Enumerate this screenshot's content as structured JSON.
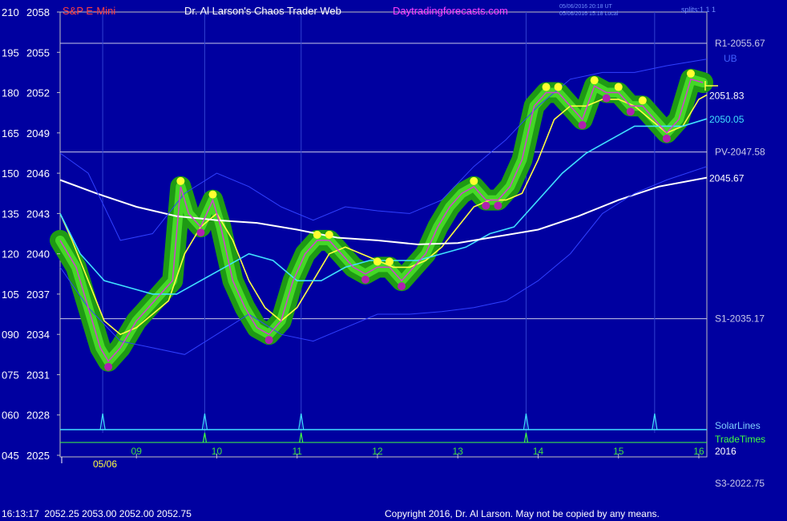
{
  "header": {
    "instrument": "S&P E-Mini",
    "site_title": "Dr. Al Larson's Chaos Trader Web",
    "site_url": "Daytradingforecasts.com",
    "timestamp_ut": "05/06/2016 20:18 UT",
    "timestamp_local": "05/06/2016 15:18 Local",
    "splits": "splits:1 1 1"
  },
  "footer": {
    "quote": "16:13:17  2052.25 2053.00 2052.00 2052.75",
    "copyright": "Copyright 2016, Dr. Al Larson. May not be copied by any means."
  },
  "chart_data": {
    "type": "line",
    "x_tick_labels": [
      "09",
      "10",
      "11",
      "12",
      "13",
      "14",
      "15",
      "16"
    ],
    "x_tick_hours": [
      9,
      10,
      11,
      12,
      13,
      14,
      15,
      16
    ],
    "date_label": "05/06",
    "year_label": "2016",
    "xlim": [
      8.05,
      16.1
    ],
    "ylim": [
      2025,
      2058
    ],
    "price_ticks": [
      2025,
      2028,
      2031,
      2034,
      2037,
      2040,
      2043,
      2046,
      2049,
      2052,
      2055,
      2058
    ],
    "osc_ticks": [
      "045",
      "060",
      "075",
      "090",
      "105",
      "120",
      "135",
      "150",
      "165",
      "180",
      "195",
      "210"
    ],
    "levels": [
      {
        "label": "R1-2055.67",
        "value": 2055.67,
        "color": "#c8c8e8"
      },
      {
        "label": "PV-2047.58",
        "value": 2047.58,
        "color": "#c8c8e8"
      },
      {
        "label": "S1-2035.17",
        "value": 2035.17,
        "color": "#c8c8e8"
      }
    ],
    "offchart_levels": [
      "S3-2022.75"
    ],
    "value_labels": [
      {
        "text": "2051.83",
        "value": 2051.83,
        "color": "#ffffff"
      },
      {
        "text": "2050.05",
        "value": 2050.05,
        "color": "#40e0ff"
      },
      {
        "text": "2045.67",
        "value": 2045.67,
        "color": "#ffffff"
      }
    ],
    "ub_label": "UB",
    "lower_labels": [
      "SolarLines",
      "TradeTimes"
    ],
    "timing_lines": [
      8.58,
      9.85,
      11.05,
      13.85,
      15.45
    ],
    "series": [
      {
        "role": "price",
        "color": "#a0ff40",
        "x": [
          8.05,
          8.15,
          8.25,
          8.4,
          8.55,
          8.65,
          8.8,
          9,
          9.15,
          9.3,
          9.45,
          9.55,
          9.65,
          9.8,
          9.95,
          10.05,
          10.2,
          10.35,
          10.5,
          10.65,
          10.8,
          10.95,
          11.1,
          11.25,
          11.4,
          11.55,
          11.7,
          11.85,
          12,
          12.15,
          12.3,
          12.45,
          12.6,
          12.75,
          12.9,
          13.05,
          13.2,
          13.35,
          13.5,
          13.65,
          13.8,
          13.95,
          14.1,
          14.25,
          14.4,
          14.55,
          14.7,
          14.85,
          15,
          15.15,
          15.3,
          15.45,
          15.6,
          15.75,
          15.9,
          16.05
        ],
        "y": [
          2041,
          2040,
          2039,
          2036,
          2033,
          2032,
          2033,
          2035,
          2036,
          2037,
          2038,
          2045,
          2043,
          2042,
          2044,
          2042,
          2038,
          2036,
          2034.5,
          2034,
          2035,
          2038,
          2040,
          2041,
          2041,
          2040,
          2039,
          2038.5,
          2039,
          2039,
          2038,
          2039,
          2040,
          2042,
          2043.5,
          2044.5,
          2045,
          2044,
          2044,
          2045,
          2047,
          2051,
          2052,
          2052,
          2051,
          2050,
          2052.5,
          2052,
          2052,
          2051,
          2051,
          2050,
          2049,
          2050,
          2053,
          2052.75
        ]
      },
      {
        "role": "fast-average",
        "color": "#ffff40",
        "x": [
          8.05,
          8.2,
          8.4,
          8.6,
          8.8,
          9,
          9.2,
          9.4,
          9.6,
          9.8,
          10,
          10.2,
          10.4,
          10.6,
          10.8,
          11,
          11.2,
          11.4,
          11.6,
          11.8,
          12,
          12.2,
          12.4,
          12.6,
          12.8,
          13,
          13.2,
          13.4,
          13.6,
          13.8,
          14,
          14.2,
          14.4,
          14.6,
          14.8,
          15,
          15.2,
          15.4,
          15.6,
          15.8,
          16,
          16.1
        ],
        "y": [
          2043,
          2041,
          2038,
          2035,
          2034,
          2034.5,
          2035.5,
          2036.5,
          2040,
          2042,
          2043,
          2041,
          2038,
          2036,
          2035,
          2036,
          2038,
          2040,
          2040.5,
          2040,
          2039.5,
          2039,
          2039,
          2039.5,
          2040.5,
          2042,
          2043.5,
          2044,
          2044,
          2044.5,
          2047,
          2050,
          2051,
          2051,
          2051.5,
          2051.5,
          2051,
          2050,
          2049,
          2049.5,
          2051.5,
          2051.83
        ]
      },
      {
        "role": "slow-average",
        "color": "#40e0ff",
        "x": [
          8.05,
          8.3,
          8.6,
          8.9,
          9.2,
          9.5,
          9.8,
          10.1,
          10.4,
          10.7,
          11,
          11.3,
          11.6,
          11.9,
          12.2,
          12.5,
          12.8,
          13.1,
          13.4,
          13.7,
          14,
          14.3,
          14.6,
          14.9,
          15.2,
          15.5,
          15.8,
          16.1
        ],
        "y": [
          2043,
          2040,
          2038,
          2037.5,
          2037,
          2037,
          2038,
          2039,
          2040,
          2039.5,
          2038,
          2038,
          2039,
          2039.5,
          2039.5,
          2039.5,
          2040,
          2040.5,
          2041.5,
          2042,
          2044,
          2046,
          2047.5,
          2048.5,
          2049.5,
          2049.5,
          2049.5,
          2050.05
        ]
      },
      {
        "role": "long-average",
        "color": "#ffffff",
        "x": [
          8.05,
          8.5,
          9,
          9.5,
          10,
          10.5,
          11,
          11.5,
          12,
          12.5,
          13,
          13.5,
          14,
          14.5,
          15,
          15.5,
          16.1
        ],
        "y": [
          2045.5,
          2044.5,
          2043.5,
          2042.8,
          2042.5,
          2042.3,
          2041.8,
          2041.2,
          2041,
          2040.7,
          2040.8,
          2041.3,
          2041.8,
          2042.8,
          2044,
          2045,
          2045.67
        ]
      },
      {
        "role": "upper-band",
        "color": "#3040ff",
        "x": [
          8.05,
          8.4,
          8.8,
          9.2,
          9.6,
          10,
          10.4,
          10.8,
          11.2,
          11.6,
          12,
          12.4,
          12.8,
          13.2,
          13.6,
          14,
          14.4,
          14.8,
          15.2,
          15.6,
          16.1
        ],
        "y": [
          2047.5,
          2046,
          2041,
          2041.5,
          2044.5,
          2046,
          2045,
          2043.5,
          2042.5,
          2043.5,
          2043.2,
          2043,
          2044,
          2046.5,
          2048.5,
          2051,
          2053,
          2053.5,
          2053.5,
          2054,
          2054.5
        ]
      },
      {
        "role": "lower-band",
        "color": "#3040ff",
        "x": [
          8.05,
          8.4,
          8.8,
          9.2,
          9.6,
          10,
          10.4,
          10.8,
          11.2,
          11.6,
          12,
          12.4,
          12.8,
          13.2,
          13.6,
          14,
          14.4,
          14.8,
          15.2,
          15.6,
          16.1
        ],
        "y": [
          2039,
          2036,
          2033.5,
          2033,
          2032.5,
          2034,
          2035.5,
          2034,
          2033.5,
          2034.5,
          2035.5,
          2035.5,
          2035.7,
          2036,
          2036.5,
          2038,
          2040,
          2043,
          2044.5,
          2045.5,
          2046.5
        ]
      }
    ]
  }
}
